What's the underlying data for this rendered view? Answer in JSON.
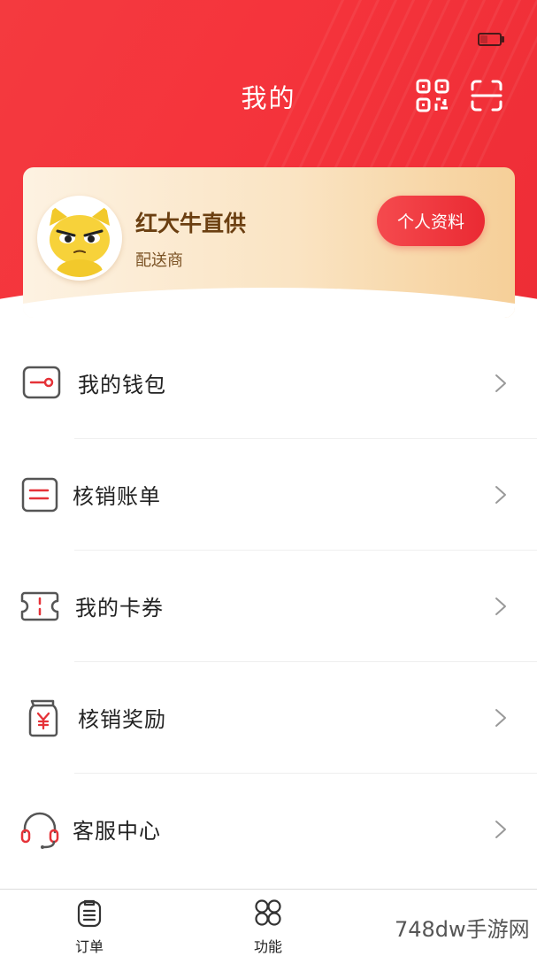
{
  "header": {
    "title": "我的",
    "qr_icon": "qr-code-icon",
    "scan_icon": "scan-icon",
    "background_color": "#f43a3f"
  },
  "status_bar": {
    "battery_icon": "battery-low-icon"
  },
  "profile": {
    "name": "红大牛直供",
    "role": "配送商",
    "button_label": "个人资料",
    "avatar_icon": "cartoon-cat-avatar"
  },
  "menu": {
    "items": [
      {
        "label": "我的钱包",
        "icon": "wallet-icon"
      },
      {
        "label": "核销账单",
        "icon": "bill-icon"
      },
      {
        "label": "我的卡券",
        "icon": "coupon-icon"
      },
      {
        "label": "核销奖励",
        "icon": "reward-jar-icon"
      },
      {
        "label": "客服中心",
        "icon": "headset-icon"
      }
    ]
  },
  "tabbar": {
    "tabs": [
      {
        "label": "订单",
        "icon": "clipboard-icon"
      },
      {
        "label": "功能",
        "icon": "four-circles-icon"
      }
    ]
  },
  "watermark": "748dw手游网",
  "colors": {
    "accent": "#ea2a33",
    "card_gold": "#f6cf98",
    "name_brown": "#6b3f11"
  }
}
